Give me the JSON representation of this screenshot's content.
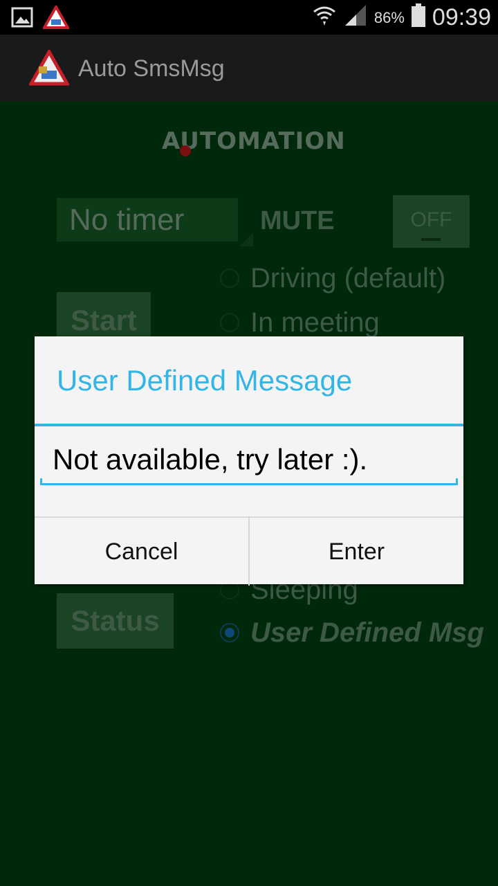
{
  "status_bar": {
    "battery_percent": "86%",
    "time": "09:39",
    "icons": [
      "gallery-icon",
      "app-notification-icon",
      "wifi-icon",
      "signal-icon",
      "battery-icon"
    ]
  },
  "action_bar": {
    "title": "Auto SmsMsg",
    "icon": "app-logo-icon"
  },
  "main": {
    "logo_text": "AUTOMATION",
    "timer_select": {
      "value": "No timer"
    },
    "mute": {
      "label": "MUTE",
      "toggle_state": "OFF"
    },
    "start_button": "Start",
    "status_button": "Status",
    "radio_options": [
      {
        "label": "Driving (default)",
        "checked": false
      },
      {
        "label": "In meeting",
        "checked": false
      },
      {
        "label": "Sleeping",
        "checked": false
      },
      {
        "label": "User Defined Msg",
        "checked": true
      }
    ]
  },
  "dialog": {
    "title": "User Defined Message",
    "input_value": "Not available, try later :).",
    "cancel_label": "Cancel",
    "enter_label": "Enter"
  },
  "colors": {
    "accent": "#33b5e5",
    "content_background": "#00290b",
    "dialog_background": "#f4f4f4"
  }
}
